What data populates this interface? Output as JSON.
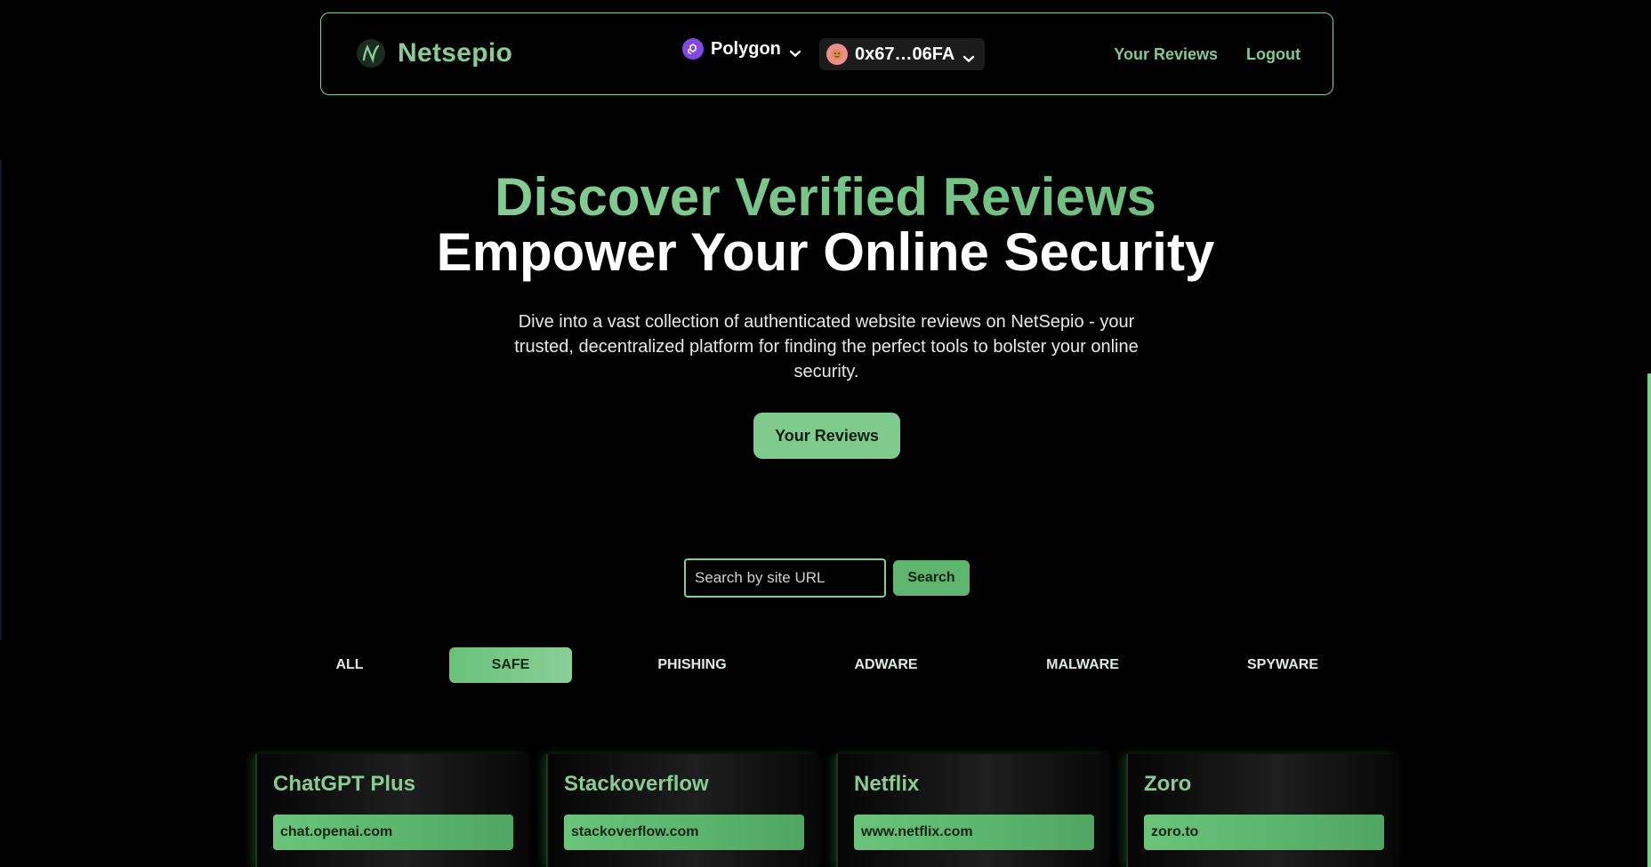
{
  "navbar": {
    "brand": "Netsepio",
    "chain": "Polygon",
    "account": "0x67…06FA",
    "links": [
      "Your Reviews",
      "Logout"
    ]
  },
  "hero": {
    "title": "Discover Verified Reviews",
    "subtitle": "Empower Your Online Security",
    "description": "Dive into a vast collection of authenticated website reviews on NetSepio - your trusted, decentralized platform for finding the perfect tools to bolster your online security.",
    "button": "Your Reviews"
  },
  "search": {
    "placeholder": "Search by site URL",
    "button": "Search"
  },
  "tabs": [
    "ALL",
    "SAFE",
    "PHISHING",
    "ADWARE",
    "MALWARE",
    "SPYWARE"
  ],
  "active_tab": "SAFE",
  "cards": [
    {
      "title": "ChatGPT Plus",
      "url": "chat.openai.com",
      "title_color": "#86cd92"
    },
    {
      "title": "Stackoverflow",
      "url": "stackoverflow.com",
      "title_color": "#86cd92"
    },
    {
      "title": "Netflix",
      "url": "www.netflix.com",
      "title_color": "#86cd92"
    },
    {
      "title": "Zoro",
      "url": "zoro.to",
      "title_color": "#86cd92"
    }
  ],
  "colors": {
    "accent": "#7fcb8e",
    "background": "#000000",
    "polygon": "#8247e5"
  },
  "icons": {
    "brand": "netsepio-logo-icon",
    "chain": "polygon-icon",
    "avatar": "avatar-icon",
    "chevron": "chevron-down-icon"
  }
}
